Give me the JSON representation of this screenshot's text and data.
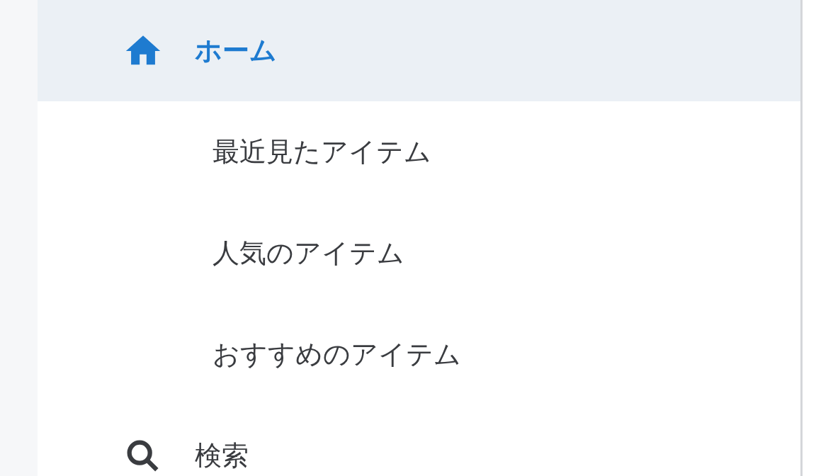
{
  "nav": [
    {
      "kind": "home",
      "label": "ホーム",
      "selected": true,
      "children": [
        {
          "label": "最近見たアイテム",
          "selected": false
        },
        {
          "label": "人気のアイテム",
          "selected": false
        },
        {
          "label": "おすすめのアイテム",
          "selected": false
        }
      ]
    },
    {
      "kind": "search",
      "label": "検索",
      "selected": false
    }
  ]
}
